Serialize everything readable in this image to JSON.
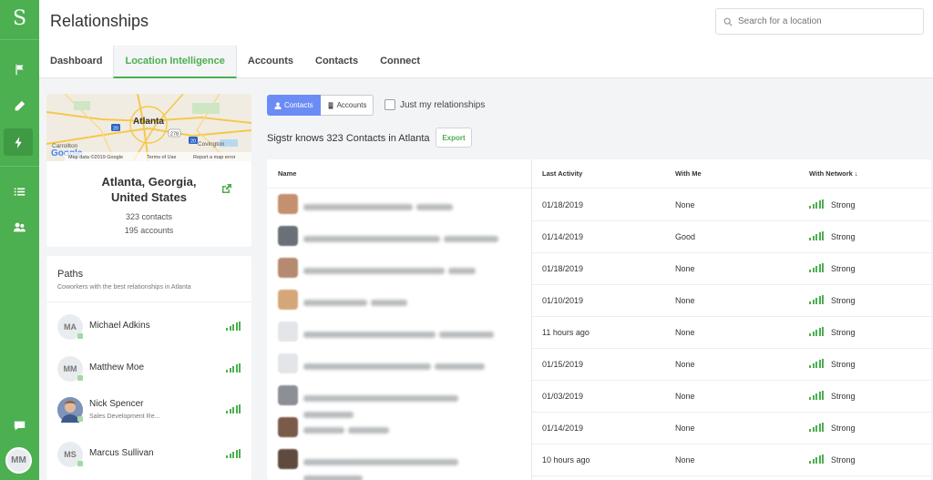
{
  "rail": {
    "logo": "S",
    "avatar_initials": "MM"
  },
  "header": {
    "title": "Relationships",
    "search_placeholder": "Search for a location",
    "tabs": [
      "Dashboard",
      "Location Intelligence",
      "Accounts",
      "Contacts",
      "Connect"
    ],
    "active_tab": "Location Intelligence"
  },
  "location": {
    "map": {
      "city": "Atlanta",
      "places": [
        "Carrollton",
        "Covington"
      ],
      "routes": [
        "20",
        "278",
        "20"
      ],
      "footer": [
        "Map data ©2019 Google",
        "Terms of Use",
        "Report a map error"
      ],
      "brand": "Google"
    },
    "name": "Atlanta, Georgia, United States",
    "name_line1": "Atlanta, Georgia,",
    "name_line2": "United States",
    "contacts": "323 contacts",
    "accounts": "195 accounts"
  },
  "paths": {
    "title": "Paths",
    "subtitle": "Coworkers with the best relationships in Atlanta",
    "people": [
      {
        "initials": "MA",
        "name": "Michael Adkins",
        "role": ""
      },
      {
        "initials": "MM",
        "name": "Matthew Moe",
        "role": ""
      },
      {
        "initials": "",
        "name": "Nick Spencer",
        "role": "Sales Development Re..."
      },
      {
        "initials": "MS",
        "name": "Marcus Sullivan",
        "role": ""
      }
    ]
  },
  "toolbar": {
    "contacts_btn": "Contacts",
    "accounts_btn": "Accounts",
    "just_mine": "Just my relationships",
    "knows": "Sigstr knows 323 Contacts in Atlanta",
    "export": "Export"
  },
  "table": {
    "headers": {
      "name": "Name",
      "last_activity": "Last Activity",
      "with_me": "With Me",
      "with_network": "With Network ↓"
    },
    "rows": [
      {
        "last_activity": "01/18/2019",
        "with_me": "None",
        "with_network": "Strong"
      },
      {
        "last_activity": "01/14/2019",
        "with_me": "Good",
        "with_network": "Strong"
      },
      {
        "last_activity": "01/18/2019",
        "with_me": "None",
        "with_network": "Strong"
      },
      {
        "last_activity": "01/10/2019",
        "with_me": "None",
        "with_network": "Strong"
      },
      {
        "last_activity": "11 hours ago",
        "with_me": "None",
        "with_network": "Strong"
      },
      {
        "last_activity": "01/15/2019",
        "with_me": "None",
        "with_network": "Strong"
      },
      {
        "last_activity": "01/03/2019",
        "with_me": "None",
        "with_network": "Strong"
      },
      {
        "last_activity": "01/14/2019",
        "with_me": "None",
        "with_network": "Strong"
      },
      {
        "last_activity": "10 hours ago",
        "with_me": "None",
        "with_network": "Strong"
      }
    ]
  },
  "colors": {
    "brand_green": "#4caf50",
    "toggle_blue": "#6b8cf5"
  }
}
